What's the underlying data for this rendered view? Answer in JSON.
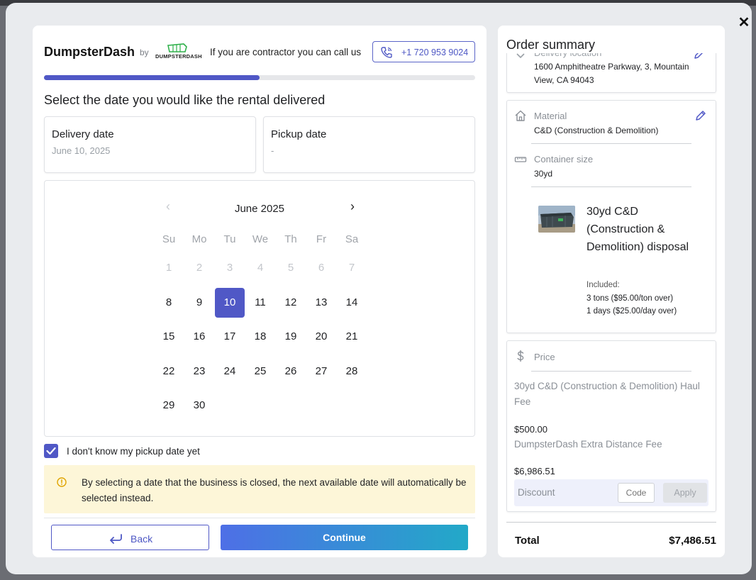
{
  "header": {
    "brand": "DumpsterDash",
    "by": "by",
    "logo_text": "DUMPSTERDASH",
    "contractor_text": "If you are contractor you can call us",
    "phone": "+1 720 953 9024"
  },
  "progress_fraction": 0.5,
  "step": {
    "heading": "Select the date you would like the rental delivered",
    "delivery_label": "Delivery date",
    "delivery_value": "June 10, 2025",
    "pickup_label": "Pickup date",
    "pickup_value": "-"
  },
  "calendar": {
    "month": "June 2025",
    "weekdays": [
      "Su",
      "Mo",
      "Tu",
      "We",
      "Th",
      "Fr",
      "Sa"
    ],
    "disabled_days": [
      "1",
      "2",
      "3",
      "4",
      "5",
      "6",
      "7"
    ],
    "weeks": [
      [
        "8",
        "9",
        "10",
        "11",
        "12",
        "13",
        "14"
      ],
      [
        "15",
        "16",
        "17",
        "18",
        "19",
        "20",
        "21"
      ],
      [
        "22",
        "23",
        "24",
        "25",
        "26",
        "27",
        "28"
      ],
      [
        "29",
        "30"
      ]
    ],
    "selected_day": "10"
  },
  "pickup_unknown": {
    "label": "I don't know my pickup date yet",
    "checked": true
  },
  "notice": "By selecting a date that the business is closed, the next available date will automatically be selected instead.",
  "buttons": {
    "back": "Back",
    "continue": "Continue"
  },
  "summary": {
    "title": "Order summary",
    "location_label": "Delivery location",
    "address": "1600 Amphitheatre Parkway, 3, Mountain View, CA 94043",
    "material_label": "Material",
    "material_value": "C&D (Construction & Demolition)",
    "size_label": "Container size",
    "size_value": "30yd",
    "product_name": "30yd C&D (Construction & Demolition) disposal",
    "included_label": "Included:",
    "included_items": [
      "3 tons ($95.00/ton over)",
      "1 days ($25.00/day over)"
    ],
    "price_label": "Price",
    "price_lines": [
      {
        "description": "30yd C&D (Construction & Demolition) Haul Fee",
        "amount": "$500.00"
      },
      {
        "description": "DumpsterDash Extra Distance Fee",
        "amount": "$6,986.51"
      }
    ],
    "discount_label": "Discount",
    "code_placeholder": "Code",
    "apply": "Apply",
    "total_label": "Total",
    "total_value": "$7,486.51"
  },
  "colors": {
    "accent": "#5058c6",
    "notice_bg": "#fdf6d8",
    "continue_gradient_start": "#4e6fe6",
    "continue_gradient_end": "#22a9c8"
  },
  "icons": [
    "close-icon",
    "phone-icon",
    "chevron-left-icon",
    "chevron-right-icon",
    "check-icon",
    "warning-icon",
    "back-arrow-icon",
    "chevron-down-icon",
    "pencil-icon",
    "house-icon",
    "ruler-icon",
    "dollar-icon"
  ]
}
